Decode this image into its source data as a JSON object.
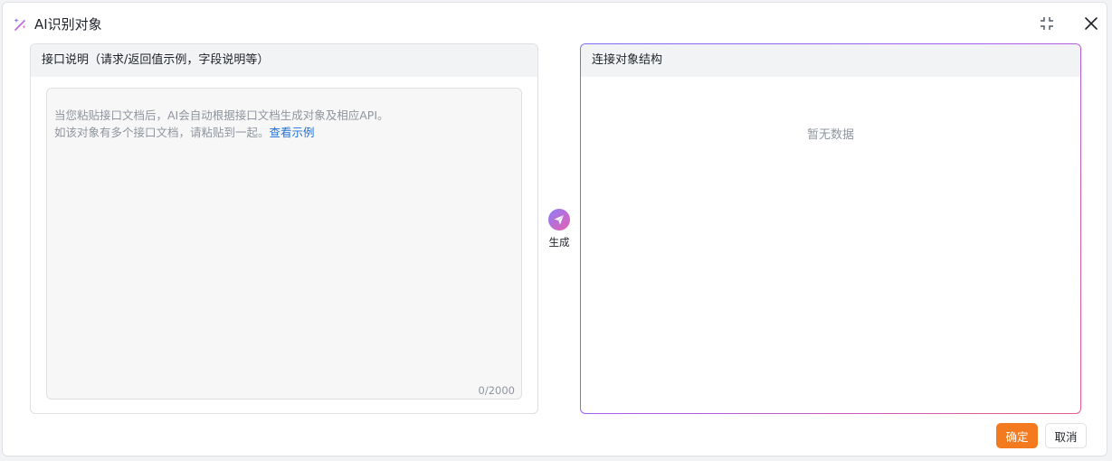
{
  "dialog": {
    "title": "AI识别对象",
    "title_icon": "magic-wand-icon",
    "collapse_icon": "collapse-icon",
    "close_icon": "close-icon"
  },
  "left_panel": {
    "header": "接口说明（请求/返回值示例，字段说明等）",
    "placeholder_line1": "当您粘贴接口文档后，AI会自动根据接口文档生成对象及相应API。",
    "placeholder_line2": "如该对象有多个接口文档，请粘贴到一起。",
    "example_link": "查看示例",
    "counter": "0/2000"
  },
  "generate": {
    "label": "生成",
    "icon": "send-icon",
    "gradient_from": "#8e7cf8",
    "gradient_to": "#e85fb0"
  },
  "right_panel": {
    "header": "连接对象结构",
    "empty_text": "暂无数据"
  },
  "footer": {
    "confirm_label": "确定",
    "cancel_label": "取消",
    "confirm_color": "#f47a1f"
  }
}
